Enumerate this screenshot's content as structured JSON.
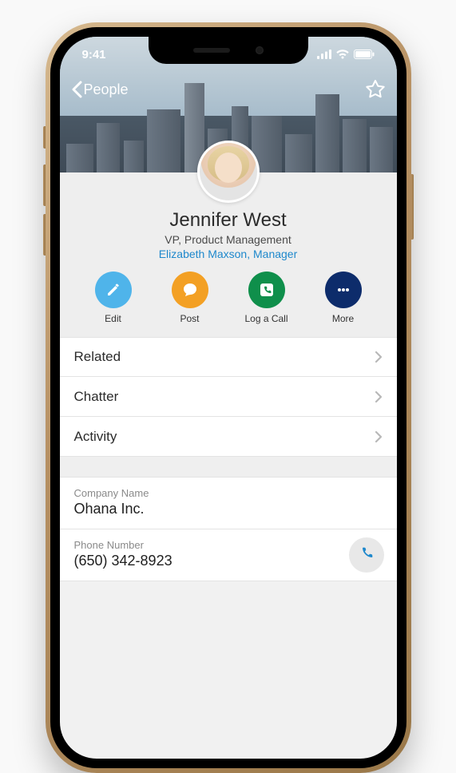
{
  "status": {
    "time": "9:41"
  },
  "nav": {
    "back_label": "People"
  },
  "profile": {
    "name": "Jennifer West",
    "title": "VP, Product Management",
    "manager": "Elizabeth Maxson, Manager"
  },
  "actions": {
    "edit": {
      "label": "Edit",
      "color": "#4fb4ea"
    },
    "post": {
      "label": "Post",
      "color": "#f3a024"
    },
    "call": {
      "label": "Log a Call",
      "color": "#0f8f4b"
    },
    "more": {
      "label": "More",
      "color": "#0d2c6b"
    }
  },
  "rows": {
    "related": "Related",
    "chatter": "Chatter",
    "activity": "Activity"
  },
  "fields": {
    "company": {
      "label": "Company Name",
      "value": "Ohana Inc."
    },
    "phone": {
      "label": "Phone Number",
      "value": "(650) 342-8923"
    }
  }
}
